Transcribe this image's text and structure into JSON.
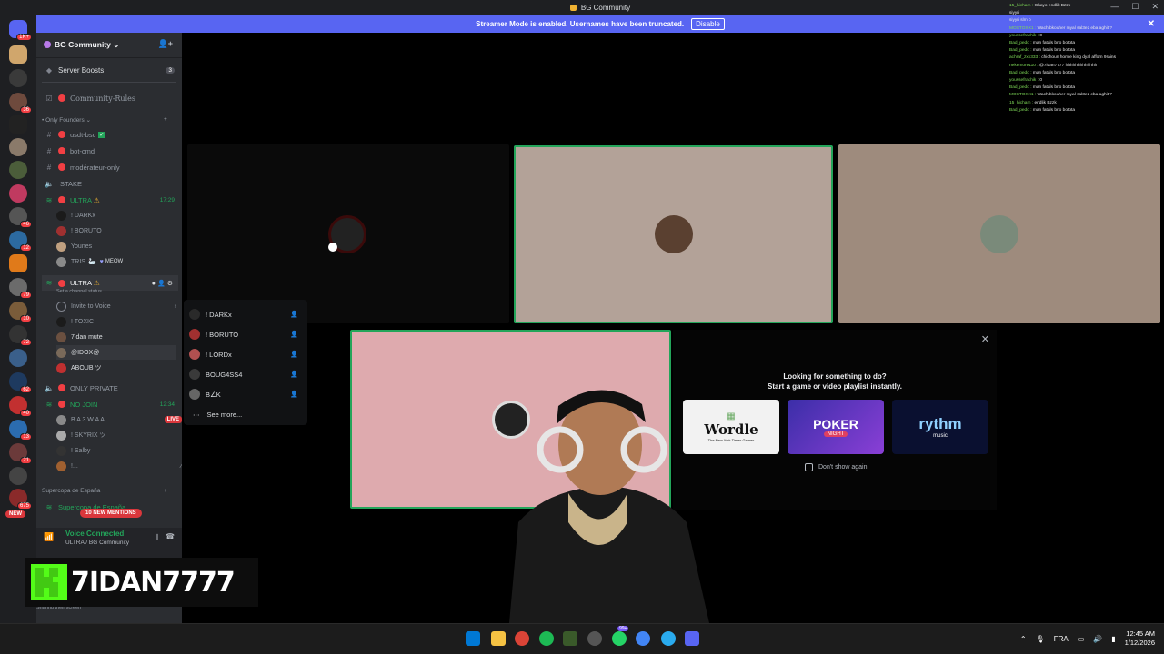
{
  "window": {
    "title": "BG Community"
  },
  "banner": {
    "text": "Streamer Mode is enabled. Usernames have been truncated.",
    "disable_label": "Disable"
  },
  "server_rail": {
    "badges": [
      "1K+",
      "36",
      "46",
      "12",
      "79",
      "10",
      "72",
      "62",
      "40",
      "13",
      "21",
      "675"
    ],
    "new_label": "NEW"
  },
  "sidebar": {
    "server_name": "BG Community",
    "server_boosts": {
      "label": "Server Boosts",
      "count": "3"
    },
    "community_rules": "Community-Rules",
    "category_only_founders": "Only Founders",
    "channels": {
      "usdt": "usdt-bsc",
      "botcmd": "bot-cmd",
      "moderateur": "modérateur-only",
      "stake": "STAKE",
      "ultra1": "ULTRA",
      "ultra1_time": "17:29",
      "ultra2": "ULTRA",
      "ultra2_status": "Set a channel status",
      "invite": "Invite to Voice",
      "only_private": "ONLY PRIVATE",
      "no_join": "NO JOIN",
      "no_join_time": "12:34"
    },
    "ultra1_users": [
      "! DARKx",
      "! BORUTO",
      "Younes",
      "TRIS"
    ],
    "ultra1_extra": "MEOW",
    "ultra2_users": [
      "! TOXIC",
      "7idan mute",
      "@IDOX@",
      "ABOUB ツ"
    ],
    "nojoin_users": [
      "B A 3 W A A",
      "! SKYRIX ツ",
      "! Salby",
      "!..."
    ],
    "live_label": "LIVE",
    "category_supercopa": "Supercopa de España",
    "supercopa_channel": "Supercopa de España",
    "mentions": "10 NEW MENTIONS",
    "voice": {
      "status": "Voice Connected",
      "location": "ULTRA / BG Community",
      "sharing": "Sharing their screen"
    }
  },
  "context_menu": {
    "items": [
      "! DARKx",
      "! BORUTO",
      "! LORDx",
      "BOUG4SS4",
      "B∠K"
    ],
    "see_more": "See more..."
  },
  "activity": {
    "heading_line1": "Looking for something to do?",
    "heading_line2": "Start a game or video playlist instantly.",
    "cards": {
      "wordle": "Wordle",
      "wordle_sub": "The New York Times Games",
      "poker": "POKER",
      "poker_sub": "NIGHT",
      "rythm": "rythm",
      "rythm_sub": "music"
    },
    "dont_show": "Don't show again"
  },
  "chat": [
    {
      "user": "15_hicham",
      "msg": "Ghayo endlik Bzzk"
    },
    {
      "user": "",
      "msg": "siyyri"
    },
    {
      "user": "",
      "msg": "siyyri slm b"
    },
    {
      "user": "MOSTOXX1",
      "msg": "Wach bkouher myal sal3ez eba aghit ?"
    },
    {
      "user": "youssefrachik",
      "msg": "0"
    },
    {
      "user": "Bad_pedo",
      "msg": "man fatals bno botota"
    },
    {
      "user": "Bad_pedo",
      "msg": "man fatals bno botota"
    },
    {
      "user": "achraf_zxx333",
      "msg": "chichoun homie king dyal afforn 9rains"
    },
    {
      "user": "nekemore110",
      "msg": "@7idan7777 hhhhhhhhhhhhh"
    },
    {
      "user": "Bad_pedo",
      "msg": "man fatals bno botota"
    },
    {
      "user": "youssefrachik",
      "msg": "0"
    },
    {
      "user": "Bad_pedo",
      "msg": "man fatals bno botota"
    },
    {
      "user": "MOSTOXX1",
      "msg": "Wach bkouher myal sal3ez eba aghit ?"
    },
    {
      "user": "15_hicham",
      "msg": "endlik Bzzk"
    },
    {
      "user": "Bad_pedo",
      "msg": "man fatals bno botota"
    }
  ],
  "overlay": {
    "brand_name": "7IDAN7777"
  },
  "taskbar": {
    "lang": "FRA",
    "time": "12:45 AM",
    "date": "1/12/2026",
    "badge": "99+"
  }
}
